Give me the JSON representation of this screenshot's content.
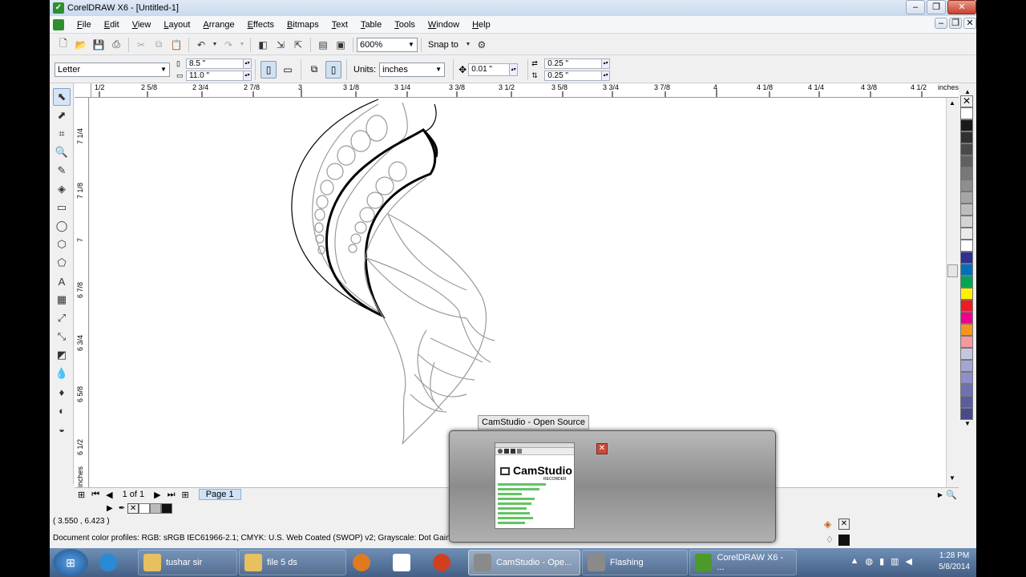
{
  "window": {
    "title": "CorelDRAW X6 - [Untitled-1]",
    "min": "‒",
    "max": "❐",
    "close": "✕"
  },
  "menu": [
    "File",
    "Edit",
    "View",
    "Layout",
    "Arrange",
    "Effects",
    "Bitmaps",
    "Text",
    "Table",
    "Tools",
    "Window",
    "Help"
  ],
  "standard": {
    "zoom": "600%",
    "snap": "Snap to"
  },
  "property": {
    "paper": "Letter",
    "width": "8.5 \"",
    "height": "11.0 \"",
    "units_label": "Units:",
    "units": "inches",
    "nudge": "0.01 \"",
    "dup_x": "0.25 \"",
    "dup_y": "0.25 \""
  },
  "ruler": {
    "h_ticks": [
      "1/2",
      "2 5/8",
      "2 3/4",
      "2 7/8",
      "3",
      "3 1/8",
      "3 1/4",
      "3 3/8",
      "3 1/2",
      "3 5/8",
      "3 3/4",
      "3 7/8",
      "4",
      "4 1/8",
      "4 1/4",
      "4 3/8",
      "4 1/2",
      "inches"
    ],
    "v_ticks": [
      "7 1/4",
      "7 1/8",
      "7",
      "6 7/8",
      "6 3/4",
      "6 5/8",
      "6 1/2"
    ],
    "v_units": "inches"
  },
  "nav": {
    "page_count": "1 of 1",
    "page_tab": "Page 1"
  },
  "status": {
    "coords": "( 3.550 , 6.423 )",
    "profiles": "Document color profiles: RGB: sRGB IEC61966-2.1; CMYK: U.S. Web Coated (SWOP) v2; Grayscale: Dot Gain 20%"
  },
  "palette": [
    "#ffffff",
    "#1a1a1a",
    "#303030",
    "#4a4a4a",
    "#606060",
    "#787878",
    "#8e8e8e",
    "#a6a6a6",
    "#bdbdbd",
    "#d4d4d4",
    "#ebebeb",
    "#ffffff",
    "#2e3192",
    "#0072bc",
    "#00a651",
    "#fff200",
    "#ed1c24",
    "#ec008c",
    "#f7941d",
    "#f5989d",
    "#c4c6e0",
    "#a3a6d4",
    "#8e8fc7",
    "#6e71b1",
    "#5a5c9e",
    "#484a8a"
  ],
  "camstudio": {
    "label": "CamStudio - Open Source",
    "brand": "CamStudio",
    "sub": "RECORDER",
    "close": "✕"
  },
  "taskbar": {
    "start": "⊞",
    "items": [
      {
        "label": "tushar sir",
        "color": "#e8c060"
      },
      {
        "label": "file 5 ds",
        "color": "#e8c060"
      },
      {
        "label": "CamStudio - Ope...",
        "color": "#8a8a8a"
      },
      {
        "label": "Flashing",
        "color": "#8a8a8a"
      },
      {
        "label": "CorelDRAW X6 - ...",
        "color": "#4c9a2a"
      }
    ],
    "time": "1:28 PM",
    "date": "5/8/2014"
  }
}
